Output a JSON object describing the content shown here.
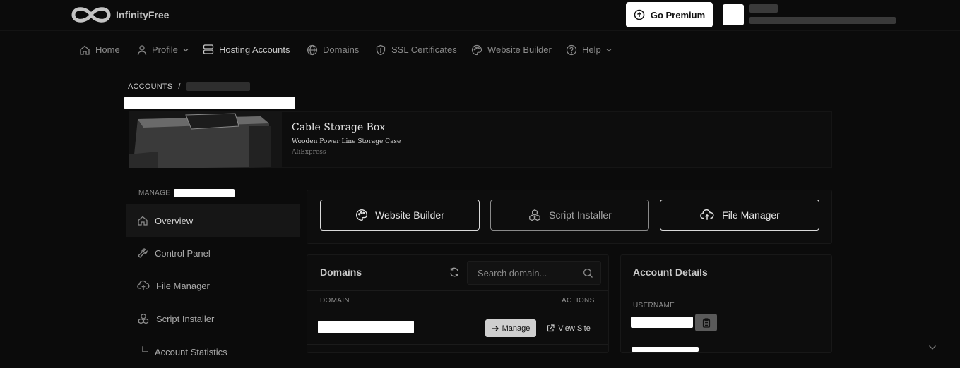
{
  "brand": {
    "name": "InfinityFree"
  },
  "header": {
    "premium_label": "Go Premium"
  },
  "nav": {
    "items": [
      {
        "label": "Home",
        "icon": "home-icon"
      },
      {
        "label": "Profile",
        "icon": "user-icon"
      },
      {
        "label": "Hosting Accounts",
        "icon": "server-icon"
      },
      {
        "label": "Domains",
        "icon": "globe-icon"
      },
      {
        "label": "SSL Certificates",
        "icon": "shield-icon"
      },
      {
        "label": "Website Builder",
        "icon": "palette-icon"
      },
      {
        "label": "Help",
        "icon": "help-circle-icon"
      }
    ]
  },
  "breadcrumb": {
    "root": "ACCOUNTS",
    "separator": "/"
  },
  "ad": {
    "title": "Cable Storage Box",
    "subtitle": "Wooden Power Line Storage Case",
    "source": "AliExpress"
  },
  "sidebar": {
    "manage_label": "MANAGE",
    "items": [
      {
        "label": "Overview",
        "icon": "home-icon"
      },
      {
        "label": "Control Panel",
        "icon": "wrench-icon"
      },
      {
        "label": "File Manager",
        "icon": "cloud-upload-icon"
      },
      {
        "label": "Script Installer",
        "icon": "cubes-icon"
      },
      {
        "label": "Account Statistics",
        "icon": "chart-icon"
      }
    ]
  },
  "quick_actions": {
    "website_builder": "Website Builder",
    "script_installer": "Script Installer",
    "file_manager": "File Manager"
  },
  "domains": {
    "title": "Domains",
    "search_placeholder": "Search domain...",
    "col_domain": "DOMAIN",
    "col_actions": "ACTIONS",
    "manage_label": "Manage",
    "view_label": "View Site"
  },
  "account_details": {
    "title": "Account Details",
    "username_label": "USERNAME"
  }
}
